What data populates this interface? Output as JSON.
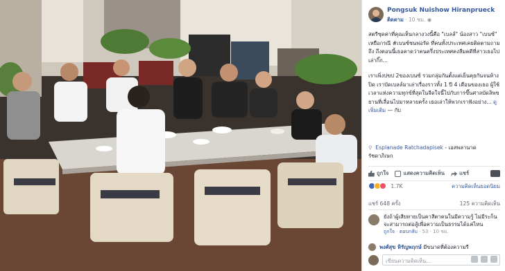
{
  "header": {
    "author": "Pongsuk Nuishow Hiranprueck",
    "follow_label": "ติดตาม",
    "time": "10 ชม."
  },
  "post": {
    "para1": "สตรีซุดค่าที่คุณเห็นกลางวงนี้คือ \"เบลล์\" น้องสาว \"เบนซ์\" เหยือกรณี #เบนซ์ชนพ่อรัด ที่คนทั้งประเทศเคยติดตามถามถึง ถึงตอนนี้เธอคาดว่าคนครึ่งประเทศคงลืมคดีที่สาวเธอไปเล่ากิ๊ก...",
    "para2": "เราเพิ่งปขป 2ของเบนซ์ รวมกลุ่มกันตั้งแต่เย็นคุยกันจนห้างปิด เราบัดเบลล์มาเล่าเรื่องราวทั้ง 1 ปี 4 เดือนของเธอ ผู้ใช้เวลาแห่งความทุกข์ที่สุดในจีดใจนี้ไปกับการขึ้นศาลบัดลิพขยานที่เลื่อนไปมาหลายครั้ง เธอเล่าให้พวกเราฟังอย่าง...",
    "more": "ดูเพิ่มเติม",
    "more_suffix": "— กับ"
  },
  "location": {
    "name": "Esplanade Ratchadapisek",
    "suffix": "- เอสพลานาด รัชดาภิเษก"
  },
  "actions": {
    "like": "ถูกใจ",
    "comment": "แสดงความคิดเห็น",
    "share": "แชร์"
  },
  "reactions": {
    "count": "1.7K",
    "link": "ความคิดเห็นยอดนิยม"
  },
  "stats": {
    "shares": "แชร์ 648 ครั้ง",
    "comments": "125 ความคิดเห็น"
  },
  "comments": [
    {
      "name": "",
      "text": "ยังถ้าผู้เสียหายเป็นคาสีตาคนในมีความรู้ ไม่มีระก็น จะสามารถต่อสู้เพื่อความเป็นธรรมได้แค่ไหน",
      "like": "ถูกใจ",
      "reply": "ตอบกลับ",
      "count": "53",
      "time": "10 ชม."
    },
    {
      "name": "พงศ์สุข หิรัญพฤกษ์",
      "text": "มีขนาดที่ต้องความรี",
      "like": "",
      "reply": "",
      "count": "",
      "time": ""
    }
  ],
  "input": {
    "placeholder": "เขียนความคิดเห็น..."
  },
  "colors": {
    "link": "#365899",
    "meta": "#90949c",
    "border": "#dddfe2"
  }
}
